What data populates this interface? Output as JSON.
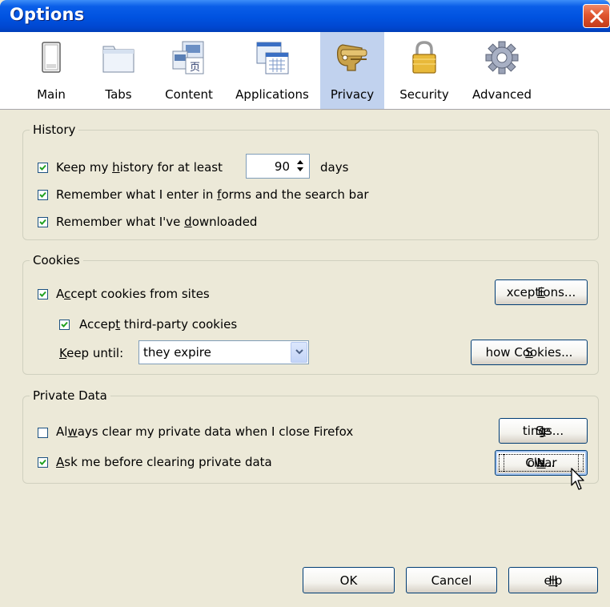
{
  "window": {
    "title": "Options"
  },
  "tabs": [
    {
      "label": "Main",
      "icon": "main-icon"
    },
    {
      "label": "Tabs",
      "icon": "tabs-icon"
    },
    {
      "label": "Content",
      "icon": "content-icon"
    },
    {
      "label": "Applications",
      "icon": "applications-icon"
    },
    {
      "label": "Privacy",
      "icon": "privacy-icon",
      "selected": true
    },
    {
      "label": "Security",
      "icon": "security-icon"
    },
    {
      "label": "Advanced",
      "icon": "advanced-icon"
    }
  ],
  "history": {
    "legend": "History",
    "keep_pre": "Keep my ",
    "keep_hot": "h",
    "keep_post": "istory for at least",
    "keep_checked": true,
    "days_value": "90",
    "days_label": "days",
    "forms_pre": "Remember what I enter in ",
    "forms_hot": "f",
    "forms_post": "orms and the search bar",
    "forms_checked": true,
    "downloads_pre": "Remember what I've ",
    "downloads_hot": "d",
    "downloads_post": "ownloaded",
    "downloads_checked": true
  },
  "cookies": {
    "legend": "Cookies",
    "accept_pre": "A",
    "accept_hot": "c",
    "accept_post": "cept cookies from sites",
    "accept_checked": true,
    "third_pre": "Accep",
    "third_hot": "t",
    "third_post": " third-party cookies",
    "third_checked": true,
    "keep_until_hot": "K",
    "keep_until_post": "eep until:",
    "keep_until_value": "they expire",
    "exceptions_hot": "E",
    "exceptions_post": "xceptions...",
    "show_hot": "S",
    "show_post": "how Cookies..."
  },
  "private_data": {
    "legend": "Private Data",
    "always_pre": "Al",
    "always_hot": "w",
    "always_post": "ays clear my private data when I close Firefox",
    "always_checked": false,
    "ask_pre": "",
    "ask_hot": "A",
    "ask_post": "sk me before clearing private data",
    "ask_checked": true,
    "settings_pre": "Se",
    "settings_hot": "t",
    "settings_post": "tings...",
    "clear_pre": "Clear ",
    "clear_hot": "N",
    "clear_post": "ow..."
  },
  "footer": {
    "ok": "OK",
    "cancel": "Cancel",
    "help_hot": "H",
    "help_post": "elp"
  },
  "colors": {
    "title_bar": "#0052e0",
    "selected_tab": "#c1d2ee",
    "dialog_bg": "#ece9d8",
    "close_button": "#e0552f"
  }
}
